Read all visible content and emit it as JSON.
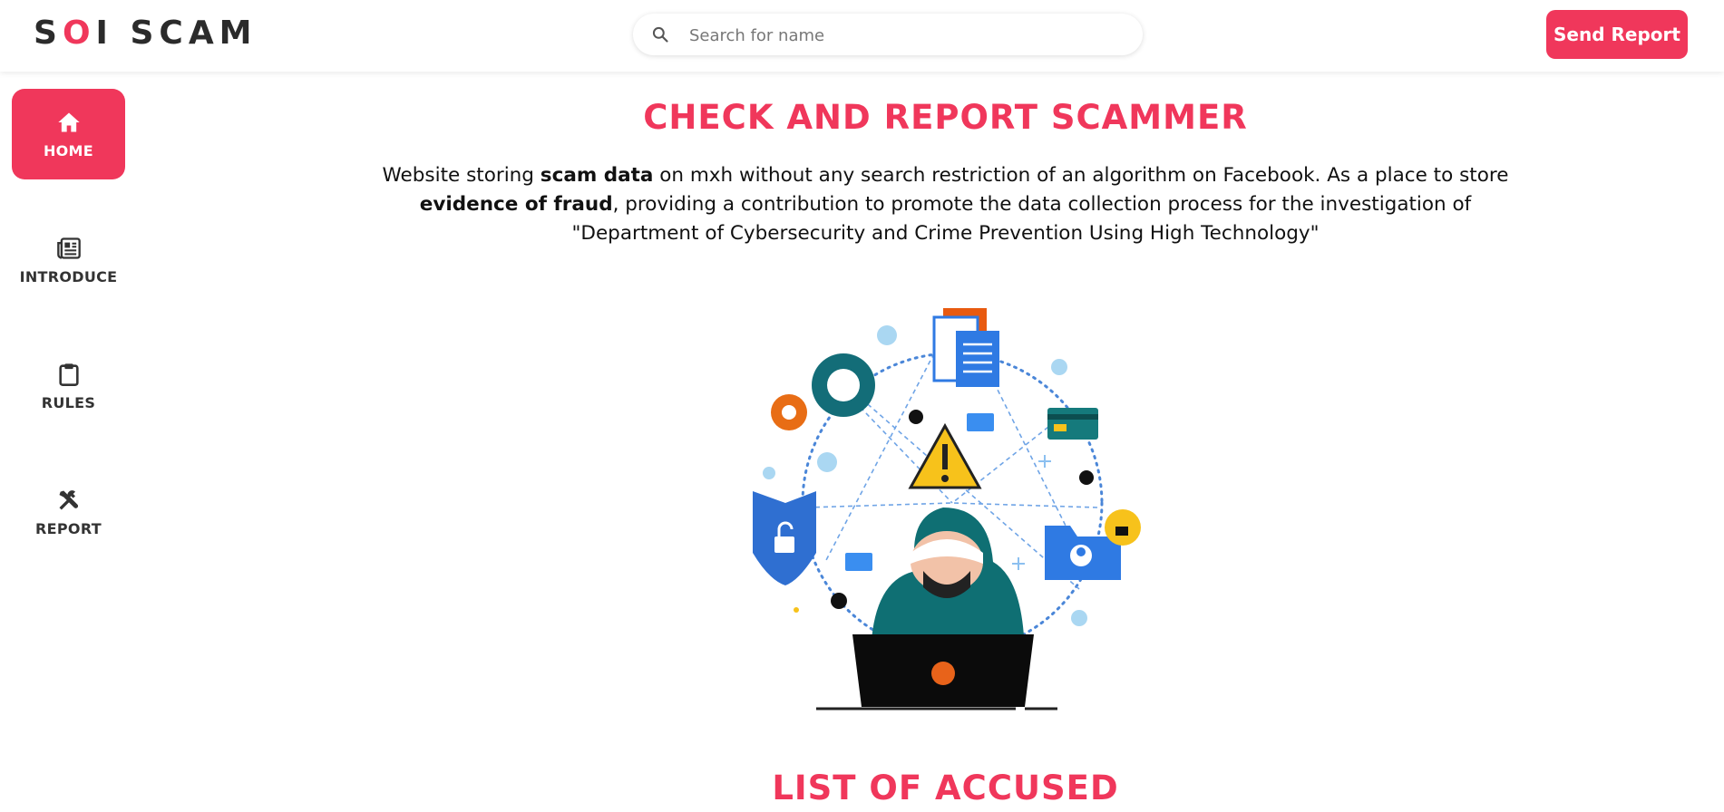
{
  "header": {
    "logo_parts": [
      "S",
      "O",
      "I SCAM"
    ],
    "search_placeholder": "Search for name",
    "send_report_label": "Send Report"
  },
  "sidebar": {
    "items": [
      {
        "label": "HOME",
        "icon": "home-icon",
        "active": true
      },
      {
        "label": "INTRODUCE",
        "icon": "newspaper-icon",
        "active": false
      },
      {
        "label": "RULES",
        "icon": "clipboard-icon",
        "active": false
      },
      {
        "label": "REPORT",
        "icon": "tools-icon",
        "active": false
      }
    ]
  },
  "main": {
    "title": "CHECK AND REPORT SCAMMER",
    "description": {
      "p1": "Website storing ",
      "b1": "scam data",
      "p2": " on mxh without any search restriction of an algorithm on Facebook. As a place to store ",
      "b2": "evidence of fraud",
      "p3": ", providing a contribution to promote the data collection process for the investigation of \"Department of Cybersecurity and Crime Prevention Using High Technology\""
    },
    "list_title": "LIST OF ACCUSED"
  },
  "colors": {
    "accent": "#f0375b",
    "text": "#111111"
  }
}
